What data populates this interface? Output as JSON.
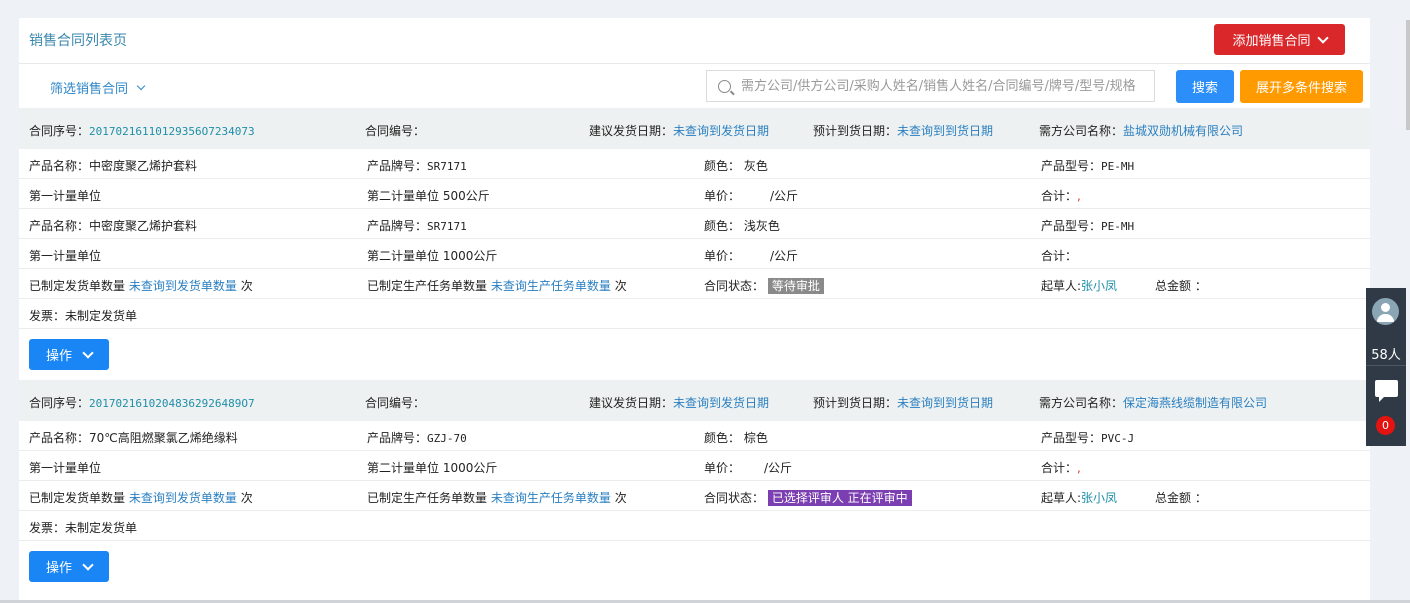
{
  "header": {
    "title": "销售合同列表页",
    "add_button": "添加销售合同"
  },
  "filter": {
    "toggle_label": "筛选销售合同",
    "search_placeholder": "需方公司/供方公司/采购人姓名/销售人姓名/合同编号/牌号/型号/规格",
    "search_button": "搜索",
    "expand_button": "展开多条件搜索"
  },
  "labels": {
    "seq": "合同序号：",
    "number": "合同编号：",
    "suggest_date": "建议发货日期：",
    "expect_date": "预计到货日期：",
    "buyer": "需方公司名称：",
    "product_name": "产品名称：",
    "brand": "产品牌号：",
    "color": "颜色：",
    "model": "产品型号：",
    "unit1": "第一计量单位",
    "unit2": "第二计量单位",
    "price": "单价：",
    "total": "合计：",
    "shipped_count": "已制定发货单数量",
    "task_count": "已制定生产任务单数量",
    "times": "次",
    "status": "合同状态：",
    "drafter": "起草人:",
    "total_amount": "总金额 ：",
    "invoice": "发票：未制定发货单",
    "op_button": "操作"
  },
  "contracts": [
    {
      "seq": "20170216110129356O7234073",
      "suggest_date": "未查询到发货日期",
      "expect_date": "未查询到到货日期",
      "buyer": "盐城双勋机械有限公司",
      "products": [
        {
          "name": "中密度聚乙烯护套料",
          "brand": "SR7171",
          "color": "灰色",
          "model": "PE-MH",
          "unit2": "500公斤",
          "price": "/公斤"
        },
        {
          "name": "中密度聚乙烯护套料",
          "brand": "SR7171",
          "color": "浅灰色",
          "model": "PE-MH",
          "unit2": "1000公斤",
          "price": "/公斤"
        }
      ],
      "shipped": "未查询到发货单数量",
      "tasks": "未查询生产任务单数量",
      "status": "等待审批",
      "drafter": "张小凤"
    },
    {
      "seq": "20170216102048362926489O7",
      "suggest_date": "未查询到发货日期",
      "expect_date": "未查询到到货日期",
      "buyer": "保定海燕线缆制造有限公司",
      "products": [
        {
          "name": "70℃高阻燃聚氯乙烯绝缘料",
          "brand": "GZJ-70",
          "color": "棕色",
          "model": "PVC-J",
          "unit2": "1000公斤",
          "price": "/公斤"
        }
      ],
      "shipped": "未查询到发货单数量",
      "tasks": "未查询生产任务单数量",
      "status": "已选择评审人 正在评审中",
      "drafter": "张小凤"
    }
  ],
  "side": {
    "online_count": "58人",
    "message_badge": "0"
  },
  "colors": {
    "red_button": "#d9272a",
    "blue_button": "#2c8ef8",
    "orange_button": "#ff9a00",
    "status_gray": "#8a8a8a",
    "status_purple": "#7b3fb2"
  }
}
